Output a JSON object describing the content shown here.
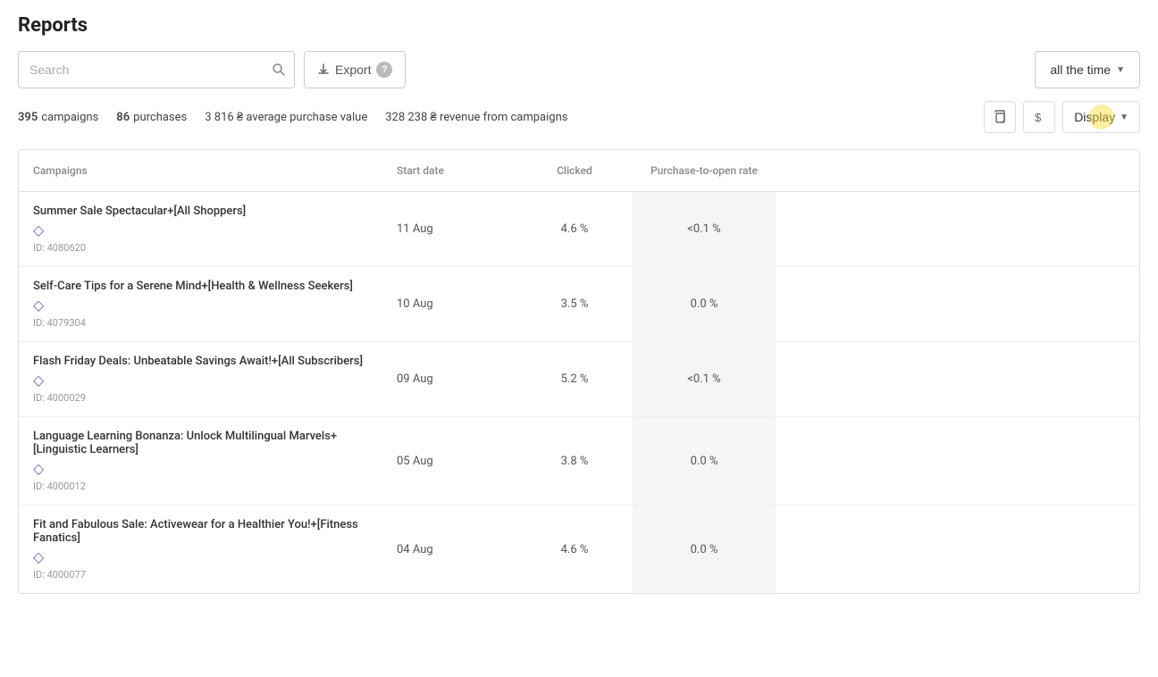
{
  "page": {
    "title": "Reports"
  },
  "toolbar": {
    "search_placeholder": "Search",
    "export_label": "Export",
    "time_filter_label": "all the time"
  },
  "stats": {
    "campaigns_count": "395",
    "campaigns_label": "campaigns",
    "purchases_count": "86",
    "purchases_label": "purchases",
    "avg_purchase_label": "3 816 ₴ average purchase value",
    "revenue_label": "328 238 ₴ revenue from campaigns",
    "display_label": "Display"
  },
  "table": {
    "columns": [
      {
        "id": "campaigns",
        "label": "Campaigns"
      },
      {
        "id": "start_date",
        "label": "Start date"
      },
      {
        "id": "clicked",
        "label": "Clicked"
      },
      {
        "id": "purchase_to_open",
        "label": "Purchase-to-open rate"
      }
    ],
    "rows": [
      {
        "name": "Summer Sale Spectacular+[All Shoppers]",
        "id": "ID: 4080620",
        "start_date": "11 Aug",
        "clicked": "4.6 %",
        "purchase_to_open": "<0.1 %"
      },
      {
        "name": "Self-Care Tips for a Serene Mind+[Health & Wellness Seekers]",
        "id": "ID: 4079304",
        "start_date": "10 Aug",
        "clicked": "3.5 %",
        "purchase_to_open": "0.0 %"
      },
      {
        "name": "Flash Friday Deals: Unbeatable Savings Await!+[All Subscribers]",
        "id": "ID: 4000029",
        "start_date": "09 Aug",
        "clicked": "5.2 %",
        "purchase_to_open": "<0.1 %"
      },
      {
        "name": "Language Learning Bonanza: Unlock Multilingual Marvels+[Linguistic Learners]",
        "id": "ID: 4000012",
        "start_date": "05 Aug",
        "clicked": "3.8 %",
        "purchase_to_open": "0.0 %"
      },
      {
        "name": "Fit and Fabulous Sale: Activewear for a Healthier You!+[Fitness Fanatics]",
        "id": "ID: 4000077",
        "start_date": "04 Aug",
        "clicked": "4.6 %",
        "purchase_to_open": "0.0 %"
      }
    ]
  }
}
